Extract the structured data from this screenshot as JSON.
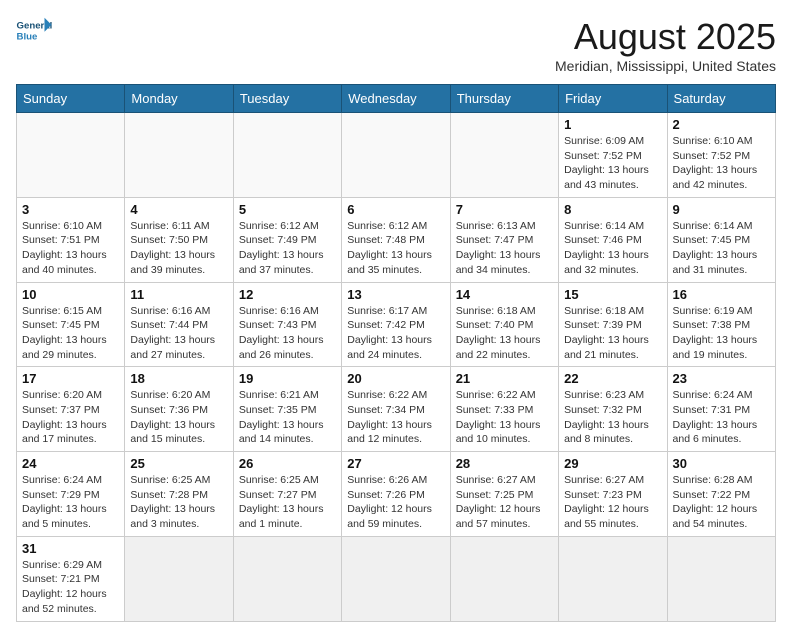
{
  "header": {
    "logo_general": "General",
    "logo_blue": "Blue",
    "month_year": "August 2025",
    "location": "Meridian, Mississippi, United States"
  },
  "weekdays": [
    "Sunday",
    "Monday",
    "Tuesday",
    "Wednesday",
    "Thursday",
    "Friday",
    "Saturday"
  ],
  "weeks": [
    [
      {
        "day": "",
        "info": ""
      },
      {
        "day": "",
        "info": ""
      },
      {
        "day": "",
        "info": ""
      },
      {
        "day": "",
        "info": ""
      },
      {
        "day": "",
        "info": ""
      },
      {
        "day": "1",
        "info": "Sunrise: 6:09 AM\nSunset: 7:52 PM\nDaylight: 13 hours and 43 minutes."
      },
      {
        "day": "2",
        "info": "Sunrise: 6:10 AM\nSunset: 7:52 PM\nDaylight: 13 hours and 42 minutes."
      }
    ],
    [
      {
        "day": "3",
        "info": "Sunrise: 6:10 AM\nSunset: 7:51 PM\nDaylight: 13 hours and 40 minutes."
      },
      {
        "day": "4",
        "info": "Sunrise: 6:11 AM\nSunset: 7:50 PM\nDaylight: 13 hours and 39 minutes."
      },
      {
        "day": "5",
        "info": "Sunrise: 6:12 AM\nSunset: 7:49 PM\nDaylight: 13 hours and 37 minutes."
      },
      {
        "day": "6",
        "info": "Sunrise: 6:12 AM\nSunset: 7:48 PM\nDaylight: 13 hours and 35 minutes."
      },
      {
        "day": "7",
        "info": "Sunrise: 6:13 AM\nSunset: 7:47 PM\nDaylight: 13 hours and 34 minutes."
      },
      {
        "day": "8",
        "info": "Sunrise: 6:14 AM\nSunset: 7:46 PM\nDaylight: 13 hours and 32 minutes."
      },
      {
        "day": "9",
        "info": "Sunrise: 6:14 AM\nSunset: 7:45 PM\nDaylight: 13 hours and 31 minutes."
      }
    ],
    [
      {
        "day": "10",
        "info": "Sunrise: 6:15 AM\nSunset: 7:45 PM\nDaylight: 13 hours and 29 minutes."
      },
      {
        "day": "11",
        "info": "Sunrise: 6:16 AM\nSunset: 7:44 PM\nDaylight: 13 hours and 27 minutes."
      },
      {
        "day": "12",
        "info": "Sunrise: 6:16 AM\nSunset: 7:43 PM\nDaylight: 13 hours and 26 minutes."
      },
      {
        "day": "13",
        "info": "Sunrise: 6:17 AM\nSunset: 7:42 PM\nDaylight: 13 hours and 24 minutes."
      },
      {
        "day": "14",
        "info": "Sunrise: 6:18 AM\nSunset: 7:40 PM\nDaylight: 13 hours and 22 minutes."
      },
      {
        "day": "15",
        "info": "Sunrise: 6:18 AM\nSunset: 7:39 PM\nDaylight: 13 hours and 21 minutes."
      },
      {
        "day": "16",
        "info": "Sunrise: 6:19 AM\nSunset: 7:38 PM\nDaylight: 13 hours and 19 minutes."
      }
    ],
    [
      {
        "day": "17",
        "info": "Sunrise: 6:20 AM\nSunset: 7:37 PM\nDaylight: 13 hours and 17 minutes."
      },
      {
        "day": "18",
        "info": "Sunrise: 6:20 AM\nSunset: 7:36 PM\nDaylight: 13 hours and 15 minutes."
      },
      {
        "day": "19",
        "info": "Sunrise: 6:21 AM\nSunset: 7:35 PM\nDaylight: 13 hours and 14 minutes."
      },
      {
        "day": "20",
        "info": "Sunrise: 6:22 AM\nSunset: 7:34 PM\nDaylight: 13 hours and 12 minutes."
      },
      {
        "day": "21",
        "info": "Sunrise: 6:22 AM\nSunset: 7:33 PM\nDaylight: 13 hours and 10 minutes."
      },
      {
        "day": "22",
        "info": "Sunrise: 6:23 AM\nSunset: 7:32 PM\nDaylight: 13 hours and 8 minutes."
      },
      {
        "day": "23",
        "info": "Sunrise: 6:24 AM\nSunset: 7:31 PM\nDaylight: 13 hours and 6 minutes."
      }
    ],
    [
      {
        "day": "24",
        "info": "Sunrise: 6:24 AM\nSunset: 7:29 PM\nDaylight: 13 hours and 5 minutes."
      },
      {
        "day": "25",
        "info": "Sunrise: 6:25 AM\nSunset: 7:28 PM\nDaylight: 13 hours and 3 minutes."
      },
      {
        "day": "26",
        "info": "Sunrise: 6:25 AM\nSunset: 7:27 PM\nDaylight: 13 hours and 1 minute."
      },
      {
        "day": "27",
        "info": "Sunrise: 6:26 AM\nSunset: 7:26 PM\nDaylight: 12 hours and 59 minutes."
      },
      {
        "day": "28",
        "info": "Sunrise: 6:27 AM\nSunset: 7:25 PM\nDaylight: 12 hours and 57 minutes."
      },
      {
        "day": "29",
        "info": "Sunrise: 6:27 AM\nSunset: 7:23 PM\nDaylight: 12 hours and 55 minutes."
      },
      {
        "day": "30",
        "info": "Sunrise: 6:28 AM\nSunset: 7:22 PM\nDaylight: 12 hours and 54 minutes."
      }
    ],
    [
      {
        "day": "31",
        "info": "Sunrise: 6:29 AM\nSunset: 7:21 PM\nDaylight: 12 hours and 52 minutes."
      },
      {
        "day": "",
        "info": ""
      },
      {
        "day": "",
        "info": ""
      },
      {
        "day": "",
        "info": ""
      },
      {
        "day": "",
        "info": ""
      },
      {
        "day": "",
        "info": ""
      },
      {
        "day": "",
        "info": ""
      }
    ]
  ]
}
